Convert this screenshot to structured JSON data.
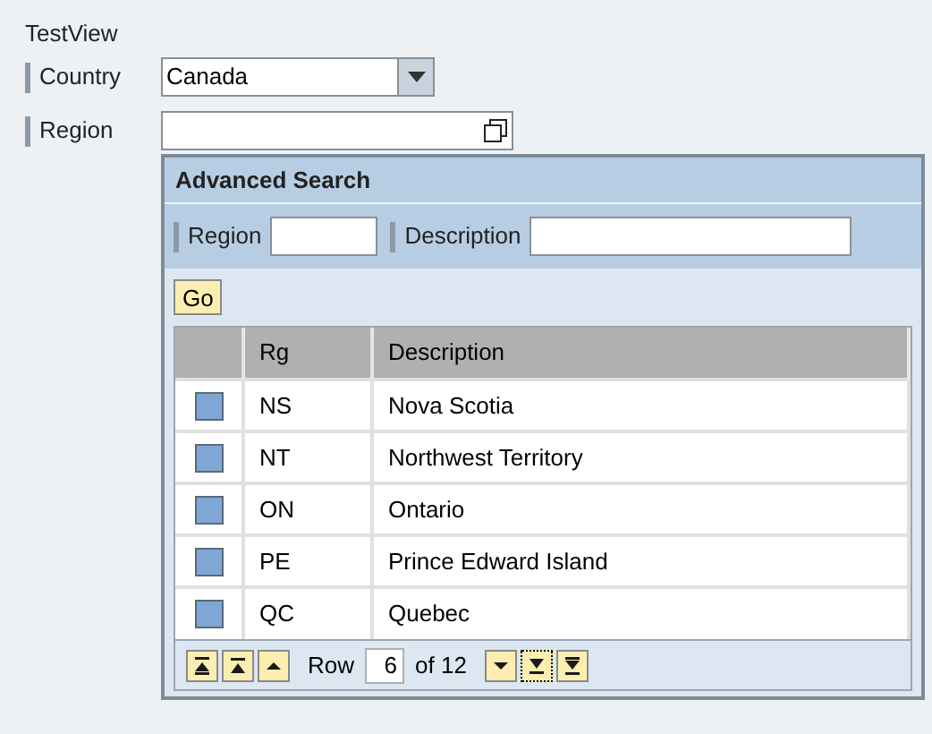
{
  "view_title": "TestView",
  "country": {
    "label": "Country",
    "value": "Canada"
  },
  "region": {
    "label": "Region"
  },
  "advanced_search": {
    "title": "Advanced Search",
    "filters": [
      {
        "label": "Region"
      },
      {
        "label": "Description"
      }
    ],
    "go_button": "Go",
    "table": {
      "columns": [
        "Rg",
        "Description"
      ],
      "rows": [
        {
          "selected": false,
          "cells": [
            "NS",
            "Nova Scotia"
          ]
        },
        {
          "selected": false,
          "cells": [
            "NT",
            "Northwest Territory"
          ]
        },
        {
          "selected": false,
          "cells": [
            "ON",
            "Ontario"
          ]
        },
        {
          "selected": false,
          "cells": [
            "PE",
            "Prince Edward Island"
          ]
        },
        {
          "selected": false,
          "cells": [
            "QC",
            "Quebec"
          ]
        }
      ]
    },
    "pager": {
      "before": [
        {
          "kind": "first",
          "focused": false
        },
        {
          "kind": "page-up",
          "focused": false
        },
        {
          "kind": "up",
          "focused": false
        }
      ],
      "row_label": "Row",
      "row_value": "6",
      "of_label": "of 12",
      "after": [
        {
          "kind": "down",
          "focused": false
        },
        {
          "kind": "page-down",
          "focused": true
        },
        {
          "kind": "last",
          "focused": false
        }
      ]
    }
  }
}
